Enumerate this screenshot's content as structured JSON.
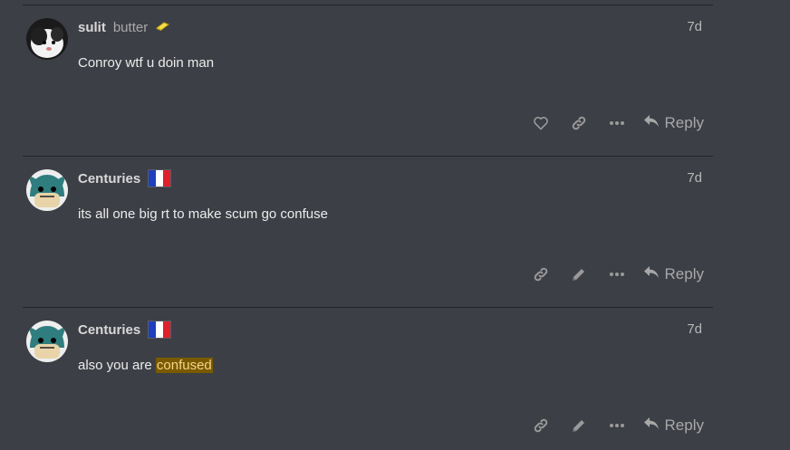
{
  "posts": [
    {
      "username": "sulit",
      "user_title": "butter",
      "badge_icon": "butter-stick-icon",
      "avatar": "cat-avatar",
      "date": "7d",
      "body_text": "Conroy wtf u doin man",
      "highlight": "",
      "actions": [
        "heart-icon",
        "link-icon",
        "more-icon"
      ],
      "reply_label": "Reply"
    },
    {
      "username": "Centuries",
      "user_title": "",
      "badge_icon": "france-flag",
      "avatar": "pokemon-avatar",
      "date": "7d",
      "body_text": "its all one big rt to make scum go confuse",
      "highlight": "",
      "actions": [
        "link-icon",
        "pencil-icon",
        "more-icon"
      ],
      "reply_label": "Reply"
    },
    {
      "username": "Centuries",
      "user_title": "",
      "badge_icon": "france-flag",
      "avatar": "pokemon-avatar",
      "date": "7d",
      "body_text": "also you are ",
      "highlight": "confused",
      "actions": [
        "link-icon",
        "pencil-icon",
        "more-icon"
      ],
      "reply_label": "Reply"
    }
  ],
  "colors": {
    "background": "#3d3f46",
    "divider": "#23252b",
    "highlight_bg": "#7a5a00",
    "flag_blue": "#1f3fbf",
    "flag_white": "#ffffff",
    "flag_red": "#e0202a"
  }
}
